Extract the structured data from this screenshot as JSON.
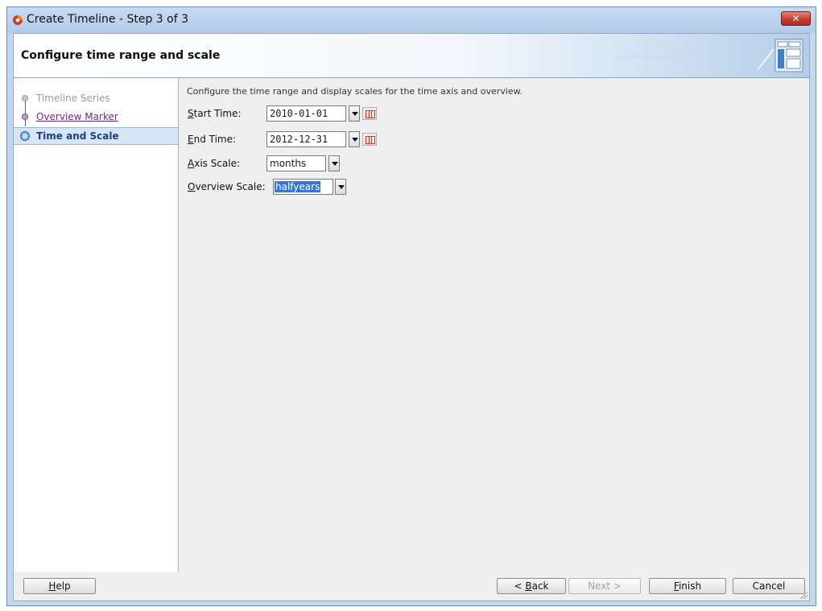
{
  "window": {
    "title": "Create Timeline - Step 3 of 3",
    "close_label": "✕"
  },
  "header": {
    "title": "Configure time range and scale",
    "binary_text": "0101010101101010101010101010101 0110101001101"
  },
  "train": {
    "items": [
      {
        "label": "Timeline Series",
        "state": "disabled"
      },
      {
        "label": "Overview Marker",
        "state": "visited"
      },
      {
        "label": "Time and Scale",
        "state": "current"
      }
    ]
  },
  "main": {
    "description": "Configure the time range and display scales for the time axis and overview.",
    "start_time": {
      "mnemonic": "S",
      "rest": "tart Time:",
      "value": "2010-01-01"
    },
    "end_time": {
      "mnemonic": "E",
      "rest": "nd Time:",
      "value": "2012-12-31"
    },
    "axis_scale": {
      "mnemonic": "A",
      "rest": "xis Scale:",
      "value": "months"
    },
    "overview_scale": {
      "mnemonic": "O",
      "rest": "verview Scale:",
      "value": "halfyears"
    }
  },
  "footer": {
    "help": {
      "mnemonic": "H",
      "rest": "elp"
    },
    "back": {
      "prefix": "< ",
      "mnemonic": "B",
      "rest": "ack"
    },
    "next": "Next >",
    "finish": {
      "mnemonic": "F",
      "rest": "inish"
    },
    "cancel": "Cancel"
  },
  "colors": {
    "accent": "#3875d7",
    "link": "#6a2b8a",
    "current_step": "#1f3f80"
  }
}
